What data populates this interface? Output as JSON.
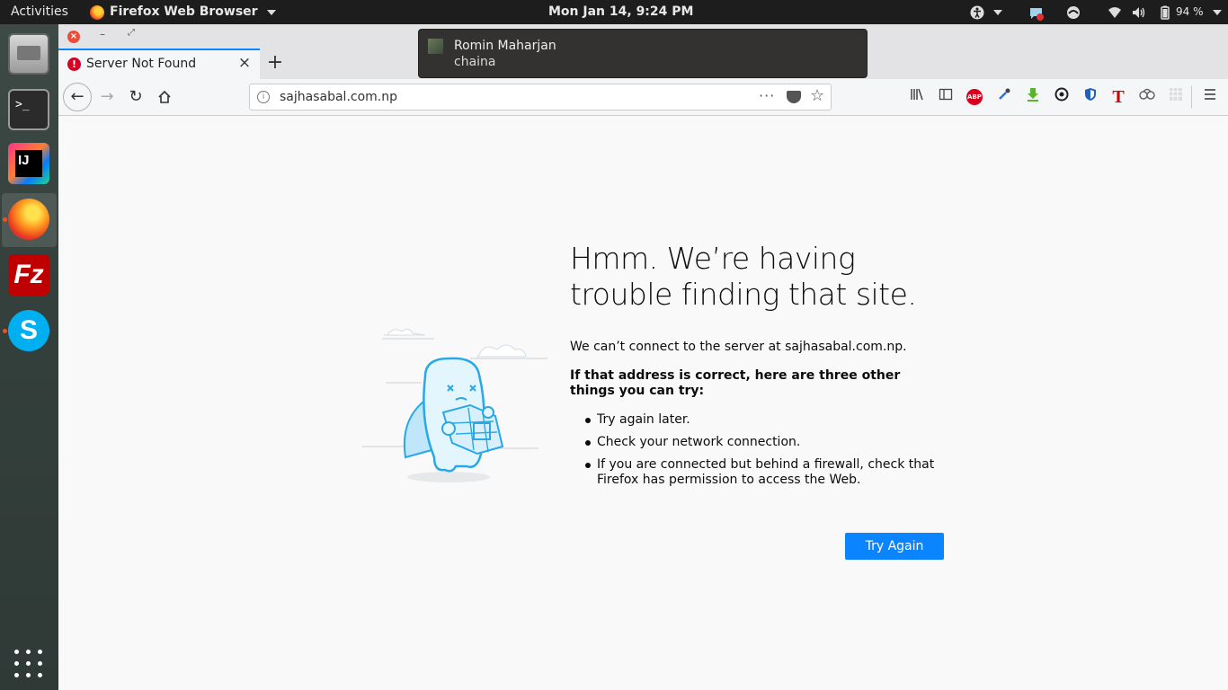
{
  "topbar": {
    "activities": "Activities",
    "app_name": "Firefox Web Browser",
    "clock": "Mon Jan 14,  9:24 PM",
    "battery": "94 %",
    "tray_icons": [
      "accessibility-icon",
      "notification-app-icon",
      "vpn-icon",
      "wifi-icon",
      "volume-icon",
      "battery-icon"
    ]
  },
  "dock": {
    "items": [
      "files",
      "terminal",
      "intellij-idea",
      "firefox",
      "filezilla",
      "skype",
      "show-applications"
    ],
    "terminal_prompt": ">_",
    "intellij_label": "IJ",
    "filezilla_label": "Fz",
    "skype_label": "S"
  },
  "browser": {
    "tab_title": "Server Not Found",
    "tab_icon": "!",
    "url": "sajhasabal.com.np",
    "url_info": "i",
    "url_more": "···",
    "url_star": "☆",
    "toolbar_icons": [
      "library-icon",
      "sidebar-icon",
      "adblock-plus-icon",
      "eyedropper-icon",
      "download-icon",
      "extension-icon",
      "shield-icon",
      "t-icon",
      "puzzle-icon",
      "grid-icon",
      "menu-icon"
    ],
    "abp_label": "ABP",
    "t_label": "T"
  },
  "error_page": {
    "title": "Hmm. We’re having trouble finding that site.",
    "description": "We can’t connect to the server at sajhasabal.com.np.",
    "suggestion_heading": "If that address is correct, here are three other things you can try:",
    "suggestions": [
      "Try again later.",
      "Check your network connection.",
      "If you are connected but behind a firewall, check that Firefox has permission to access the Web."
    ],
    "try_again_label": "Try Again"
  },
  "notification": {
    "title": "Romin Maharjan",
    "body": "chaina"
  },
  "colors": {
    "accent": "#0a84ff",
    "error_red": "#d70022",
    "topbar": "#1d1d1d"
  }
}
